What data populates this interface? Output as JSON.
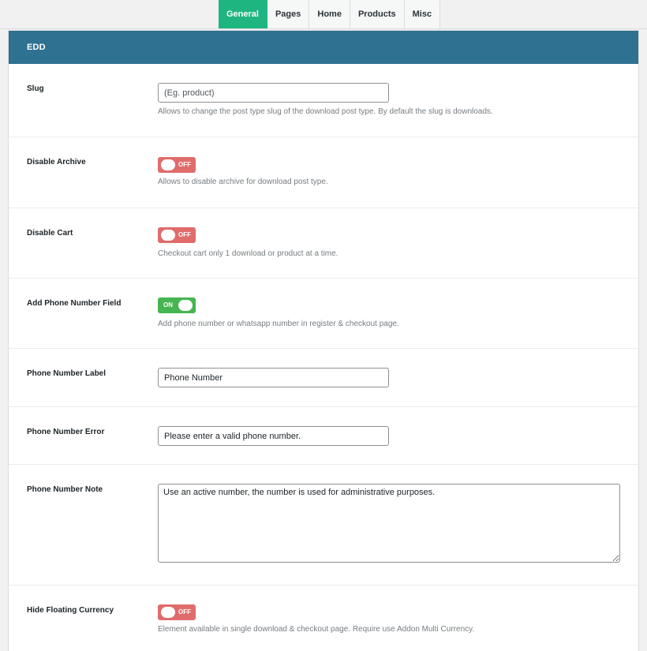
{
  "tabs": [
    {
      "label": "General",
      "active": true
    },
    {
      "label": "Pages",
      "active": false
    },
    {
      "label": "Home",
      "active": false
    },
    {
      "label": "Products",
      "active": false
    },
    {
      "label": "Misc",
      "active": false
    }
  ],
  "colors": {
    "active_tab": "#1fb580",
    "header": "#2f7190",
    "toggle_on": "#46b450",
    "toggle_off": "#e06c6c"
  },
  "section": {
    "title": "EDD"
  },
  "fields": {
    "slug": {
      "label": "Slug",
      "placeholder": "(Eg. product)",
      "value": "",
      "description": "Allows to change the post type slug of the download post type. By default the slug is downloads."
    },
    "disable_archive": {
      "label": "Disable Archive",
      "state": "OFF",
      "description": "Allows to disable archive for download post type."
    },
    "disable_cart": {
      "label": "Disable Cart",
      "state": "OFF",
      "description": "Checkout cart only 1 download or product at a time."
    },
    "add_phone": {
      "label": "Add Phone Number Field",
      "state": "ON",
      "description": "Add phone number or whatsapp number in register & checkout page."
    },
    "phone_label": {
      "label": "Phone Number Label",
      "value": "Phone Number"
    },
    "phone_error": {
      "label": "Phone Number Error",
      "value": "Please enter a valid phone number."
    },
    "phone_note": {
      "label": "Phone Number Note",
      "value": "Use an active number, the number is used for administrative purposes."
    },
    "hide_currency": {
      "label": "Hide Floating Currency",
      "state": "OFF",
      "description": "Element available in single download & checkout page. Require use Addon Multi Currency."
    }
  }
}
